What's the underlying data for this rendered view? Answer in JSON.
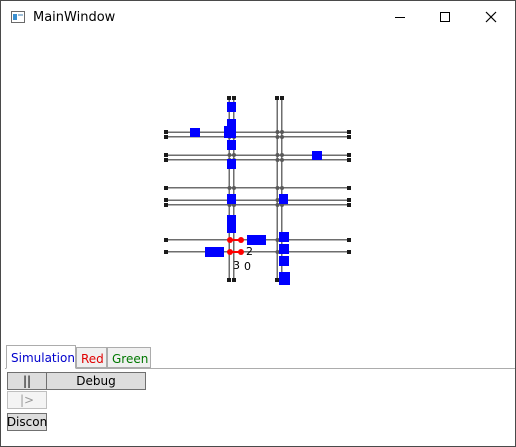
{
  "window": {
    "title": "MainWindow",
    "controls": {
      "minimize_icon": "minimize-icon",
      "maximize_icon": "maximize-icon",
      "close_icon": "close-icon"
    }
  },
  "scene": {
    "labels": [
      {
        "text": "2"
      },
      {
        "text": "3"
      },
      {
        "text": "0"
      }
    ],
    "colors": {
      "vehicle": "#0000ff",
      "signal": "#ff0000",
      "road": "#6e6e6e"
    }
  },
  "tabs": [
    {
      "label": "Simulation",
      "color": "#0000cc",
      "active": true
    },
    {
      "label": "Red",
      "color": "#e00000",
      "active": false
    },
    {
      "label": "Green",
      "color": "#007800",
      "active": false
    }
  ],
  "panel": {
    "pause_label": "||",
    "debug_label": "Debug",
    "step_label": "|>",
    "disconnect_label": "Discon"
  }
}
